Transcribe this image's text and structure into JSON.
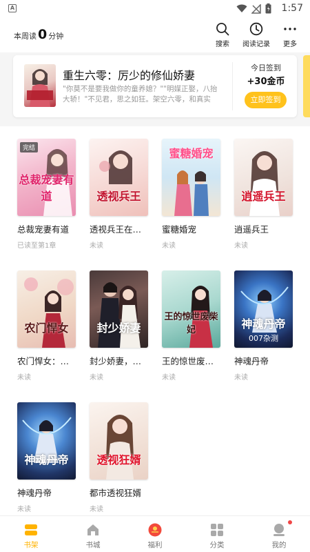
{
  "status_bar": {
    "time": "1:57",
    "app_icon": "A"
  },
  "header": {
    "read_prefix": "本周读",
    "read_minutes": "0",
    "read_suffix": "分钟",
    "actions": [
      {
        "icon": "search-icon",
        "label": "搜索"
      },
      {
        "icon": "clock-icon",
        "label": "阅读记录"
      },
      {
        "icon": "more-icon",
        "label": "更多"
      }
    ]
  },
  "featured": {
    "title": "重生六零：厉少的修仙娇妻",
    "description": "\"你莫不是要我做你的童养媳？\"\"明媒正娶，八抬大轿！\"不见君，思之如狂。架空六零，和真实",
    "checkin_label": "今日签到",
    "checkin_reward": "+30金币",
    "checkin_button": "立即签到",
    "accent_color": "#ffc21c"
  },
  "books": [
    {
      "title": "总裁宠妻有道",
      "progress": "已读至第1章",
      "badge": "完结",
      "cover_text": "总裁宠妻有道"
    },
    {
      "title": "透视兵王在…",
      "progress": "未读",
      "cover_text": "透视兵王"
    },
    {
      "title": "蜜糖婚宠",
      "progress": "未读",
      "cover_text": "蜜糖婚宠"
    },
    {
      "title": "逍遥兵王",
      "progress": "未读",
      "cover_text": "逍遥兵王"
    },
    {
      "title": "农门悍女：…",
      "progress": "未读",
      "cover_text": "农门悍女"
    },
    {
      "title": "封少娇妻，…",
      "progress": "未读",
      "cover_text": "封少娇妻"
    },
    {
      "title": "王的惊世废…",
      "progress": "未读",
      "cover_text": "王的惊世废柴妃"
    },
    {
      "title": "神魂丹帝",
      "progress": "未读",
      "cover_text": "神魂丹帝",
      "cover_sub": "007杂测"
    },
    {
      "title": "神魂丹帝",
      "progress": "未读",
      "cover_text": "神魂丹帝"
    },
    {
      "title": "都市透视狂婿",
      "progress": "未读",
      "cover_text": "透视狂婿"
    }
  ],
  "tabs": [
    {
      "icon": "bookshelf-icon",
      "label": "书架",
      "active": true
    },
    {
      "icon": "bookstore-icon",
      "label": "书城"
    },
    {
      "icon": "redpacket-icon",
      "label": "福利"
    },
    {
      "icon": "category-icon",
      "label": "分类"
    },
    {
      "icon": "profile-icon",
      "label": "我的"
    }
  ]
}
